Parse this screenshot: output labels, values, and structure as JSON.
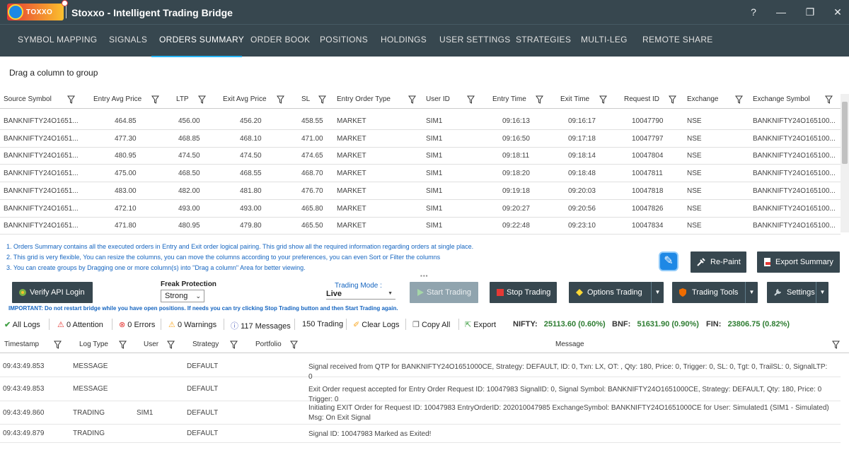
{
  "app": {
    "title": "Stoxxo - Intelligent Trading Bridge",
    "logo_text": "TOXXO"
  },
  "window_controls": [
    "?",
    "—",
    "❐",
    "✕"
  ],
  "tabs": [
    "SYMBOL MAPPING",
    "SIGNALS",
    "ORDERS SUMMARY",
    "ORDER BOOK",
    "POSITIONS",
    "HOLDINGS",
    "USER SETTINGS",
    "STRATEGIES",
    "MULTI-LEG",
    "REMOTE SHARE"
  ],
  "active_tab": "ORDERS SUMMARY",
  "group_area": "Drag a column to group",
  "orders": {
    "columns": [
      "Source Symbol",
      "Entry Avg Price",
      "LTP",
      "Exit Avg Price",
      "SL",
      "Entry Order Type",
      "User ID",
      "Entry Time",
      "Exit Time",
      "Request ID",
      "Exchange",
      "Exchange Symbol"
    ],
    "rows": [
      [
        "BANKNIFTY24O1651...",
        "464.85",
        "456.00",
        "456.20",
        "458.55",
        "MARKET",
        "SIM1",
        "09:16:13",
        "09:16:17",
        "10047790",
        "NSE",
        "BANKNIFTY24O165100..."
      ],
      [
        "BANKNIFTY24O1651...",
        "477.30",
        "468.85",
        "468.10",
        "471.00",
        "MARKET",
        "SIM1",
        "09:16:50",
        "09:17:18",
        "10047797",
        "NSE",
        "BANKNIFTY24O165100..."
      ],
      [
        "BANKNIFTY24O1651...",
        "480.95",
        "474.50",
        "474.50",
        "474.65",
        "MARKET",
        "SIM1",
        "09:18:11",
        "09:18:14",
        "10047804",
        "NSE",
        "BANKNIFTY24O165100..."
      ],
      [
        "BANKNIFTY24O1651...",
        "475.00",
        "468.50",
        "468.55",
        "468.70",
        "MARKET",
        "SIM1",
        "09:18:20",
        "09:18:48",
        "10047811",
        "NSE",
        "BANKNIFTY24O165100..."
      ],
      [
        "BANKNIFTY24O1651...",
        "483.00",
        "482.00",
        "481.80",
        "476.70",
        "MARKET",
        "SIM1",
        "09:19:18",
        "09:20:03",
        "10047818",
        "NSE",
        "BANKNIFTY24O165100..."
      ],
      [
        "BANKNIFTY24O1651...",
        "472.10",
        "493.00",
        "493.00",
        "465.80",
        "MARKET",
        "SIM1",
        "09:20:27",
        "09:20:56",
        "10047826",
        "NSE",
        "BANKNIFTY24O165100..."
      ],
      [
        "BANKNIFTY24O1651...",
        "471.80",
        "480.95",
        "479.80",
        "465.50",
        "MARKET",
        "SIM1",
        "09:22:48",
        "09:23:10",
        "10047834",
        "NSE",
        "BANKNIFTY24O165100..."
      ]
    ]
  },
  "info_lines": [
    "1. Orders Summary contains all the executed orders in Entry and Exit order logical pairing. This grid show all the required information regarding orders at single place.",
    "2. This grid is very flexible, You can resize the columns, you can move the columns according to your preferences, you can even Sort or Filter the columns",
    "3. You can create groups by Dragging one or more column(s) into \"Drag a column\" Area for better viewing."
  ],
  "buttons": {
    "repaint": "Re-Paint",
    "export_summary": "Export Summary",
    "verify_api": "Verify API Login",
    "start_trading": "Start Trading",
    "stop_trading": "Stop Trading",
    "options_trading": "Options Trading",
    "trading_tools": "Trading Tools",
    "settings": "Settings"
  },
  "freak_protection": {
    "label": "Freak Protection",
    "value": "Strong"
  },
  "trading_mode": {
    "label": "Trading Mode :",
    "value": "Live"
  },
  "important": "IMPORTANT: Do not restart bridge while you have open positions. If needs you can try clicking Stop Trading button and then Start Trading again.",
  "log_toolbar": {
    "all_logs": "All Logs",
    "attention": "0 Attention",
    "errors": "0 Errors",
    "warnings": "0 Warnings",
    "messages": "117 Messages",
    "trading": "150 Trading",
    "clear_logs": "Clear Logs",
    "copy_all": "Copy All",
    "export": "Export"
  },
  "tickers": [
    {
      "label": "NIFTY:",
      "value": "25113.60 (0.60%)"
    },
    {
      "label": "BNF:",
      "value": "51631.90 (0.90%)"
    },
    {
      "label": "FIN:",
      "value": "23806.75 (0.82%)"
    }
  ],
  "logs": {
    "columns": [
      "Timestamp",
      "Log Type",
      "User",
      "Strategy",
      "Portfolio",
      "Message"
    ],
    "rows": [
      {
        "time": "09:43:49.853",
        "type": "MESSAGE",
        "user": "",
        "strategy": "DEFAULT",
        "portfolio": "",
        "message": "Signal received from QTP for BANKNIFTY24O1651000CE, Strategy: DEFAULT, ID: 0, Txn: LX, OT: , Qty: 180, Price: 0, Trigger: 0, SL: 0, Tgt: 0, TrailSL: 0, SignalLTP: 0"
      },
      {
        "time": "09:43:49.853",
        "type": "MESSAGE",
        "user": "",
        "strategy": "DEFAULT",
        "portfolio": "",
        "message": "Exit Order request accepted for Entry Order Request ID: 10047983  SignalID: 0, Signal Symbol: BANKNIFTY24O1651000CE, Strategy: DEFAULT, Qty: 180, Price: 0 Trigger: 0"
      },
      {
        "time": "09:43:49.860",
        "type": "TRADING",
        "user": "SIM1",
        "strategy": "DEFAULT",
        "portfolio": "",
        "message": "Initiating EXIT Order for Request ID: 10047983  EntryOrderID: 202010047985  ExchangeSymbol: BANKNIFTY24O1651000CE  for User: Simulated1 (SIM1 - Simulated)  Msg: On Exit Signal"
      },
      {
        "time": "09:43:49.879",
        "type": "TRADING",
        "user": "",
        "strategy": "DEFAULT",
        "portfolio": "",
        "message": "Signal ID: 10047983 Marked as Exited!"
      }
    ]
  },
  "colors": {
    "chrome": "#37474f",
    "accent": "#29b6f6",
    "info_text": "#1565c0",
    "positive": "#2e7d32"
  }
}
